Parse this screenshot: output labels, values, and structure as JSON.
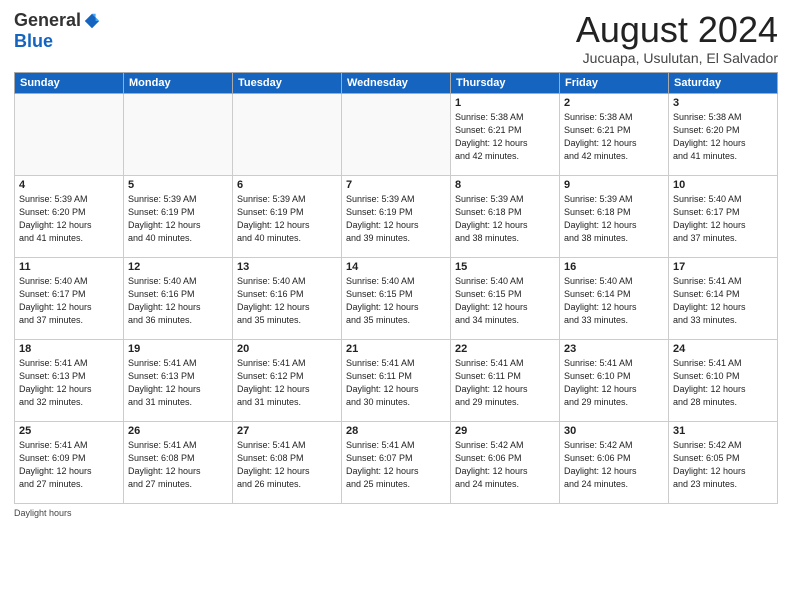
{
  "header": {
    "logo_general": "General",
    "logo_blue": "Blue",
    "title": "August 2024",
    "location": "Jucuapa, Usulutan, El Salvador"
  },
  "days_of_week": [
    "Sunday",
    "Monday",
    "Tuesday",
    "Wednesday",
    "Thursday",
    "Friday",
    "Saturday"
  ],
  "weeks": [
    [
      {
        "day": "",
        "info": ""
      },
      {
        "day": "",
        "info": ""
      },
      {
        "day": "",
        "info": ""
      },
      {
        "day": "",
        "info": ""
      },
      {
        "day": "1",
        "info": "Sunrise: 5:38 AM\nSunset: 6:21 PM\nDaylight: 12 hours\nand 42 minutes."
      },
      {
        "day": "2",
        "info": "Sunrise: 5:38 AM\nSunset: 6:21 PM\nDaylight: 12 hours\nand 42 minutes."
      },
      {
        "day": "3",
        "info": "Sunrise: 5:38 AM\nSunset: 6:20 PM\nDaylight: 12 hours\nand 41 minutes."
      }
    ],
    [
      {
        "day": "4",
        "info": "Sunrise: 5:39 AM\nSunset: 6:20 PM\nDaylight: 12 hours\nand 41 minutes."
      },
      {
        "day": "5",
        "info": "Sunrise: 5:39 AM\nSunset: 6:19 PM\nDaylight: 12 hours\nand 40 minutes."
      },
      {
        "day": "6",
        "info": "Sunrise: 5:39 AM\nSunset: 6:19 PM\nDaylight: 12 hours\nand 40 minutes."
      },
      {
        "day": "7",
        "info": "Sunrise: 5:39 AM\nSunset: 6:19 PM\nDaylight: 12 hours\nand 39 minutes."
      },
      {
        "day": "8",
        "info": "Sunrise: 5:39 AM\nSunset: 6:18 PM\nDaylight: 12 hours\nand 38 minutes."
      },
      {
        "day": "9",
        "info": "Sunrise: 5:39 AM\nSunset: 6:18 PM\nDaylight: 12 hours\nand 38 minutes."
      },
      {
        "day": "10",
        "info": "Sunrise: 5:40 AM\nSunset: 6:17 PM\nDaylight: 12 hours\nand 37 minutes."
      }
    ],
    [
      {
        "day": "11",
        "info": "Sunrise: 5:40 AM\nSunset: 6:17 PM\nDaylight: 12 hours\nand 37 minutes."
      },
      {
        "day": "12",
        "info": "Sunrise: 5:40 AM\nSunset: 6:16 PM\nDaylight: 12 hours\nand 36 minutes."
      },
      {
        "day": "13",
        "info": "Sunrise: 5:40 AM\nSunset: 6:16 PM\nDaylight: 12 hours\nand 35 minutes."
      },
      {
        "day": "14",
        "info": "Sunrise: 5:40 AM\nSunset: 6:15 PM\nDaylight: 12 hours\nand 35 minutes."
      },
      {
        "day": "15",
        "info": "Sunrise: 5:40 AM\nSunset: 6:15 PM\nDaylight: 12 hours\nand 34 minutes."
      },
      {
        "day": "16",
        "info": "Sunrise: 5:40 AM\nSunset: 6:14 PM\nDaylight: 12 hours\nand 33 minutes."
      },
      {
        "day": "17",
        "info": "Sunrise: 5:41 AM\nSunset: 6:14 PM\nDaylight: 12 hours\nand 33 minutes."
      }
    ],
    [
      {
        "day": "18",
        "info": "Sunrise: 5:41 AM\nSunset: 6:13 PM\nDaylight: 12 hours\nand 32 minutes."
      },
      {
        "day": "19",
        "info": "Sunrise: 5:41 AM\nSunset: 6:13 PM\nDaylight: 12 hours\nand 31 minutes."
      },
      {
        "day": "20",
        "info": "Sunrise: 5:41 AM\nSunset: 6:12 PM\nDaylight: 12 hours\nand 31 minutes."
      },
      {
        "day": "21",
        "info": "Sunrise: 5:41 AM\nSunset: 6:11 PM\nDaylight: 12 hours\nand 30 minutes."
      },
      {
        "day": "22",
        "info": "Sunrise: 5:41 AM\nSunset: 6:11 PM\nDaylight: 12 hours\nand 29 minutes."
      },
      {
        "day": "23",
        "info": "Sunrise: 5:41 AM\nSunset: 6:10 PM\nDaylight: 12 hours\nand 29 minutes."
      },
      {
        "day": "24",
        "info": "Sunrise: 5:41 AM\nSunset: 6:10 PM\nDaylight: 12 hours\nand 28 minutes."
      }
    ],
    [
      {
        "day": "25",
        "info": "Sunrise: 5:41 AM\nSunset: 6:09 PM\nDaylight: 12 hours\nand 27 minutes."
      },
      {
        "day": "26",
        "info": "Sunrise: 5:41 AM\nSunset: 6:08 PM\nDaylight: 12 hours\nand 27 minutes."
      },
      {
        "day": "27",
        "info": "Sunrise: 5:41 AM\nSunset: 6:08 PM\nDaylight: 12 hours\nand 26 minutes."
      },
      {
        "day": "28",
        "info": "Sunrise: 5:41 AM\nSunset: 6:07 PM\nDaylight: 12 hours\nand 25 minutes."
      },
      {
        "day": "29",
        "info": "Sunrise: 5:42 AM\nSunset: 6:06 PM\nDaylight: 12 hours\nand 24 minutes."
      },
      {
        "day": "30",
        "info": "Sunrise: 5:42 AM\nSunset: 6:06 PM\nDaylight: 12 hours\nand 24 minutes."
      },
      {
        "day": "31",
        "info": "Sunrise: 5:42 AM\nSunset: 6:05 PM\nDaylight: 12 hours\nand 23 minutes."
      }
    ]
  ],
  "footer": {
    "note": "Daylight hours"
  }
}
